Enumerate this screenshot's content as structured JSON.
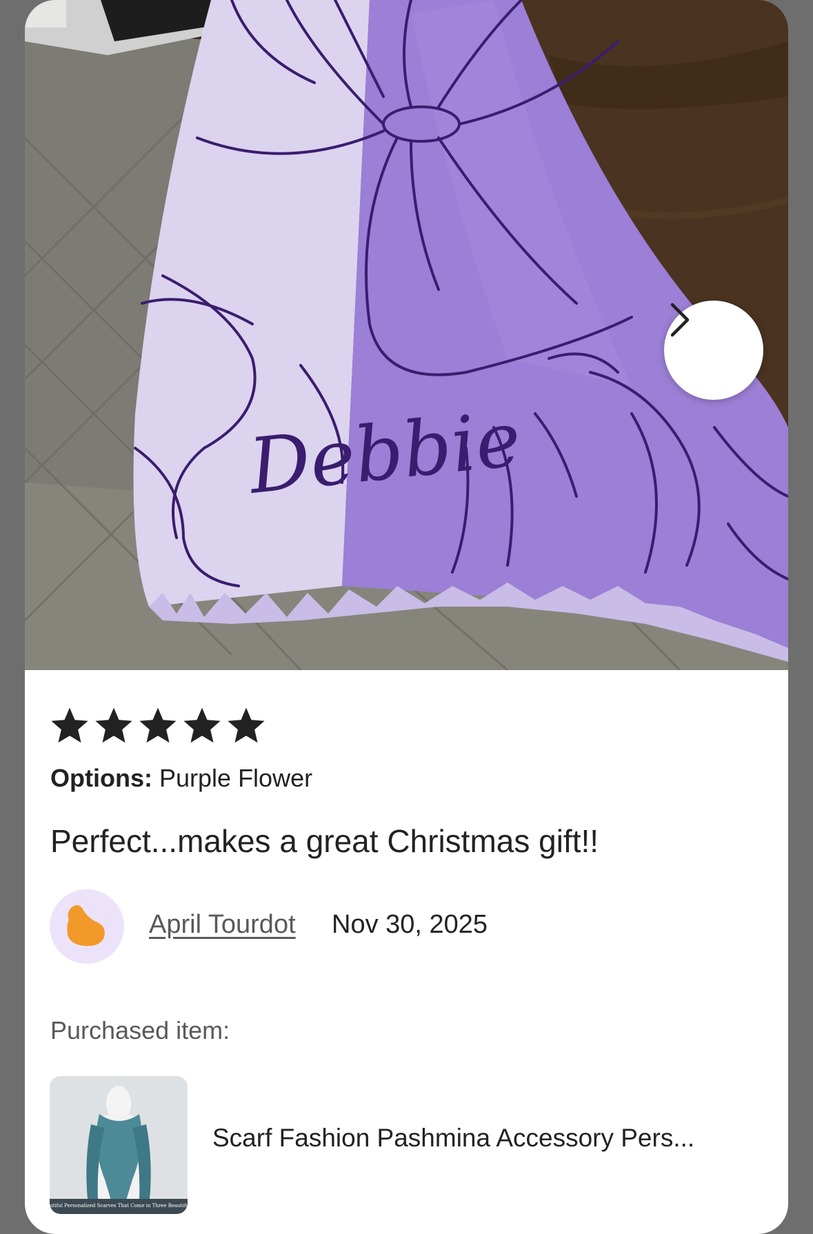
{
  "review": {
    "rating": 5,
    "rating_max": 5,
    "options_label": "Options:",
    "options_value": "Purple Flower",
    "text": "Perfect...makes a great Christmas gift!!",
    "reviewer_name": "April Tourdot",
    "date": "Nov 30, 2025"
  },
  "photo": {
    "name_on_scarf": "Debbie",
    "next_icon": "chevron-right-icon"
  },
  "purchase": {
    "label": "Purchased item:",
    "product_title": "Scarf Fashion Pashmina Accessory Pers...",
    "thumb_caption": "Our Beautiful Personalized Scarves That Come in Three Beautiful Colors"
  },
  "colors": {
    "star": "#222222",
    "scarf_light": "#dcd3ef",
    "scarf_purple": "#9c7fd6",
    "avatar_bg": "#ece3fb",
    "avatar_blob": "#f19a2a"
  }
}
